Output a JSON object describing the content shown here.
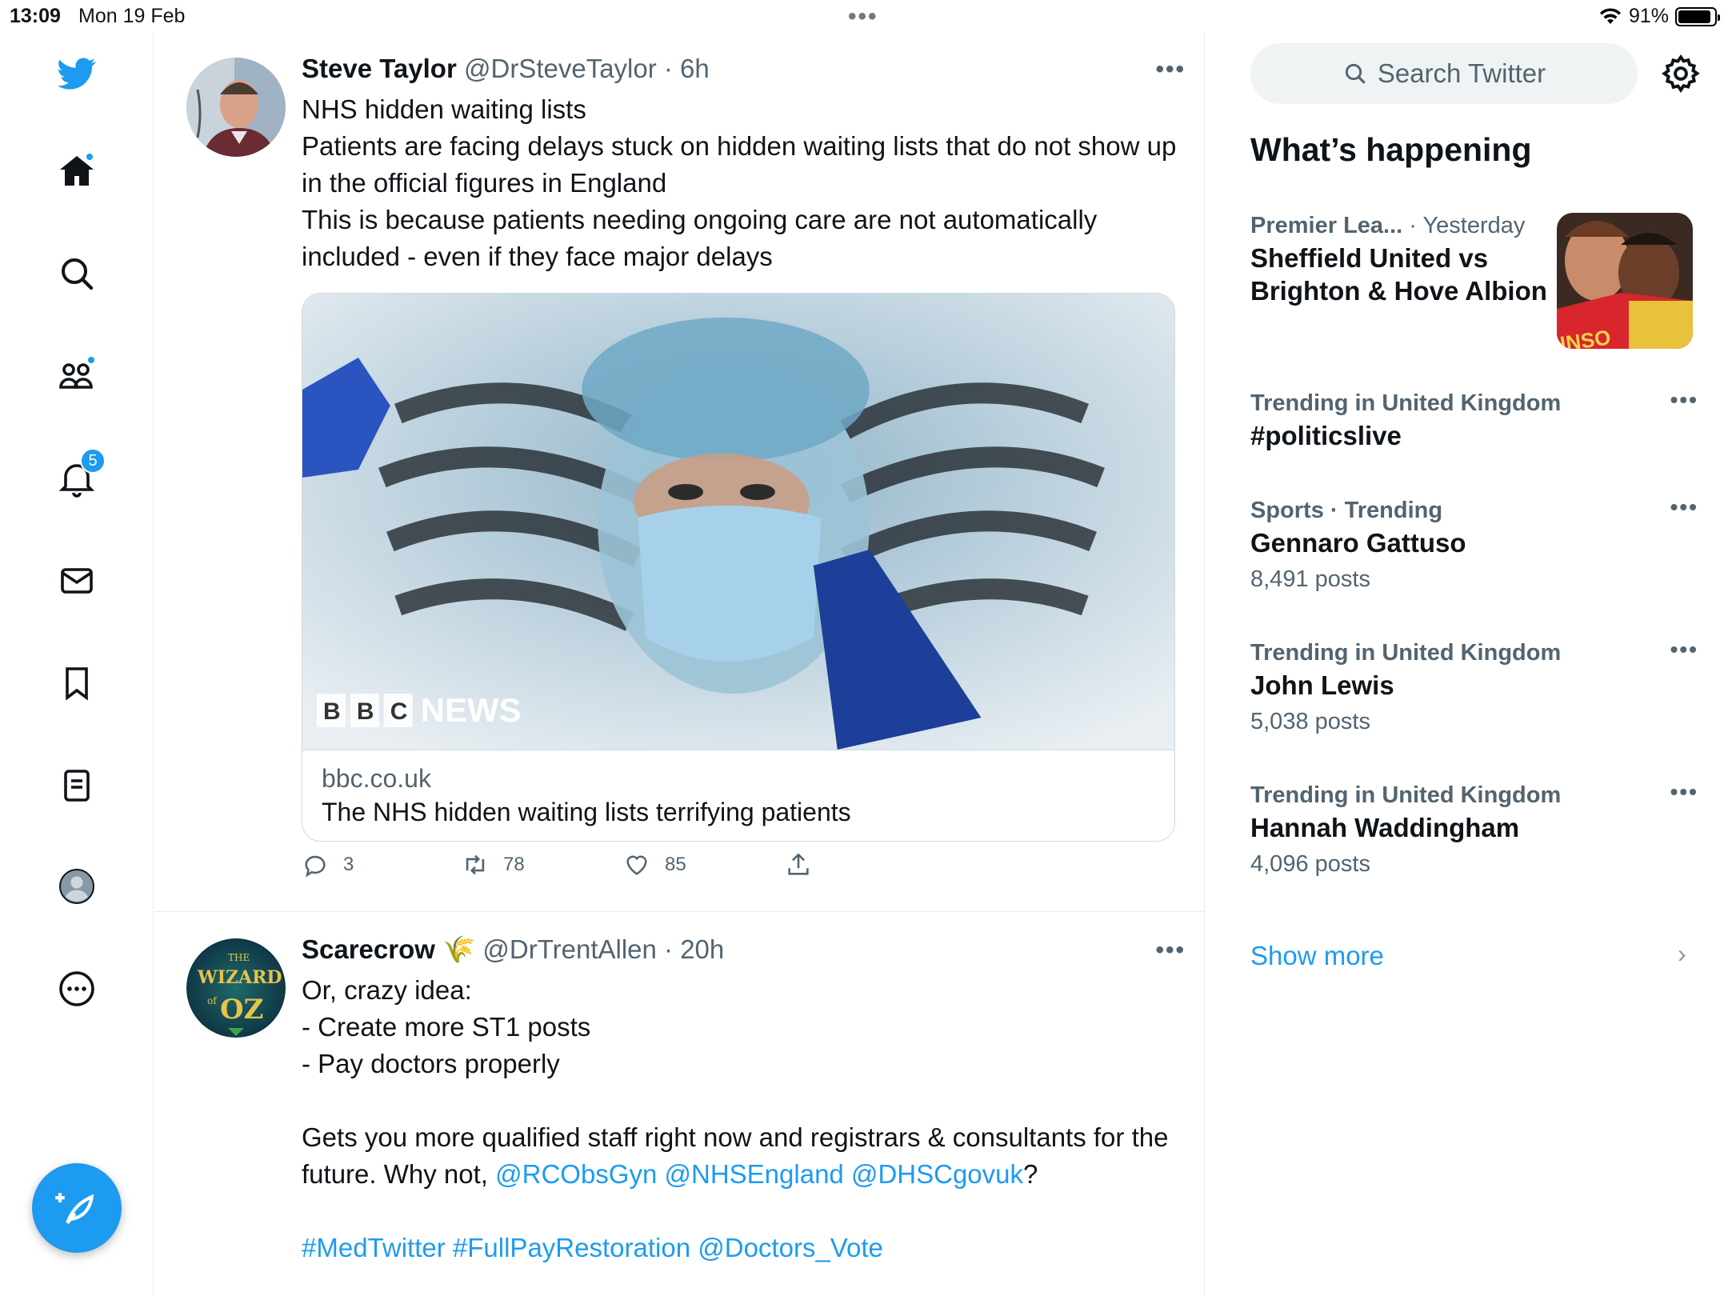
{
  "status_bar": {
    "time": "13:09",
    "date": "Mon 19 Feb",
    "battery": "91%"
  },
  "nav": {
    "items": [
      {
        "name": "twitter-logo"
      },
      {
        "name": "home"
      },
      {
        "name": "explore"
      },
      {
        "name": "communities"
      },
      {
        "name": "notifications"
      },
      {
        "name": "messages"
      },
      {
        "name": "bookmarks"
      },
      {
        "name": "lists"
      },
      {
        "name": "profile"
      },
      {
        "name": "more"
      }
    ],
    "notifications_badge": "5"
  },
  "feed": {
    "tweets": [
      {
        "name": "Steve Taylor",
        "handle": "@DrSteveTaylor",
        "time": "· 6h",
        "text": "NHS hidden waiting lists\nPatients are facing delays stuck on hidden waiting lists that do not show up in the official figures in England\nThis is because patients needing ongoing care are not automatically included - even if they face major delays",
        "card": {
          "domain": "bbc.co.uk",
          "title": "The NHS hidden waiting lists terrifying patients",
          "image_logo": {
            "b1": "B",
            "b2": "B",
            "b3": "C",
            "news": "NEWS"
          }
        },
        "replies": "3",
        "retweets": "78",
        "likes": "85"
      },
      {
        "name": "Scarecrow",
        "name_emoji": "🌾",
        "handle": "@DrTrentAllen",
        "time": "· 20h",
        "avatar_logo": {
          "the": "THE",
          "wizard": "WIZARD",
          "of": "of",
          "oz": "OZ"
        },
        "text_plain": "Or, crazy idea:\n- Create more ST1 posts\n- Pay doctors properly\n\nGets you more qualified staff right now and registrars & consultants for the future. Why not, ",
        "mentions": [
          "@RCObsGyn",
          "@NHSEngland",
          "@DHSCgovuk"
        ],
        "after_mentions": "?",
        "hashtags_line": [
          "#MedTwitter",
          "#FullPayRestoration",
          "@Doctors_Vote"
        ]
      }
    ]
  },
  "sidebar": {
    "search_placeholder": "Search Twitter",
    "heading": "What’s happening",
    "trends": [
      {
        "context": "Premier Lea...",
        "context_extra": "· Yesterday",
        "title": "Sheffield United vs Brighton & Hove Albion",
        "count": ""
      },
      {
        "context": "Trending in United Kingdom",
        "title": "#politicslive",
        "count": ""
      },
      {
        "context": "Sports · Trending",
        "title": "Gennaro Gattuso",
        "count": "8,491 posts"
      },
      {
        "context": "Trending in United Kingdom",
        "title": "John Lewis",
        "count": "5,038 posts"
      },
      {
        "context": "Trending in United Kingdom",
        "title": "Hannah Waddingham",
        "count": "4,096 posts"
      }
    ],
    "trend_image_text": "INSO",
    "show_more": "Show more"
  },
  "colors": {
    "accent": "#1d9bf0",
    "text": "#0f1419",
    "secondary": "#536471"
  }
}
